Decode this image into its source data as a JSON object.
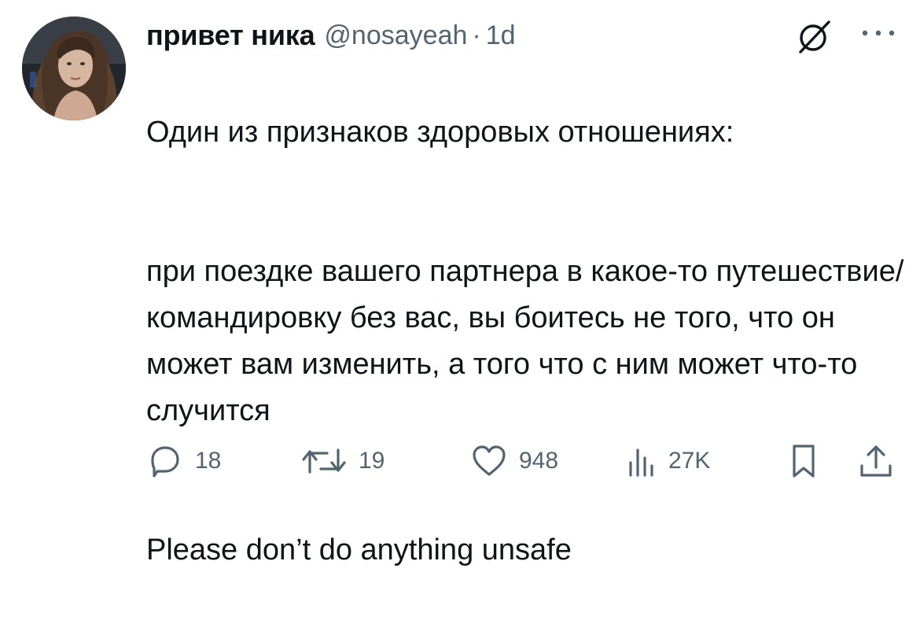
{
  "author": {
    "display_name": "привет ника",
    "handle": "@nosayeah",
    "separator": "·",
    "time": "1d"
  },
  "tweet": {
    "paragraphs": [
      "Один из признаков здоровых отношениях:",
      "при поездке вашего партнера в какое-то путешествие/командировку без вас, вы боитесь не того, что он может вам изменить, а того что с ним может что-то случится",
      "Please don’t do anything unsafe"
    ]
  },
  "actions": {
    "replies": "18",
    "retweets": "19",
    "likes": "948",
    "views": "27K"
  },
  "icons": {
    "header": [
      "grok-icon",
      "more-icon"
    ],
    "actions": [
      "reply-icon",
      "retweet-icon",
      "like-icon",
      "views-icon",
      "bookmark-icon",
      "share-icon"
    ]
  },
  "colors": {
    "text_primary": "#0f1419",
    "text_secondary": "#536471",
    "background": "#ffffff"
  }
}
